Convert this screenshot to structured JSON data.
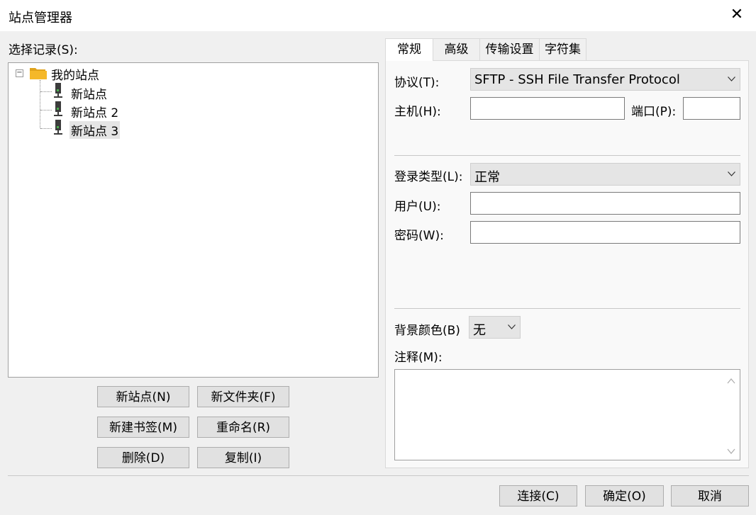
{
  "window": {
    "title": "站点管理器",
    "close_label": "✕"
  },
  "tree": {
    "label": "选择记录(S):",
    "folder": {
      "toggle": "−",
      "label": "我的站点"
    },
    "sites": [
      {
        "label": "新站点",
        "selected": false
      },
      {
        "label": "新站点 2",
        "selected": false
      },
      {
        "label": "新站点 3",
        "selected": true
      }
    ]
  },
  "left_buttons": {
    "new_site": "新站点(N)",
    "new_folder": "新文件夹(F)",
    "new_bookmark": "新建书签(M)",
    "rename": "重命名(R)",
    "delete": "删除(D)",
    "copy": "复制(I)"
  },
  "tabs": [
    {
      "label": "常规",
      "active": true
    },
    {
      "label": "高级",
      "active": false
    },
    {
      "label": "传输设置",
      "active": false
    },
    {
      "label": "字符集",
      "active": false
    }
  ],
  "general": {
    "protocol_label": "协议(T):",
    "protocol_value": "SFTP - SSH File Transfer Protocol",
    "host_label": "主机(H):",
    "host_value": "",
    "port_label": "端口(P):",
    "port_value": "",
    "logon_type_label": "登录类型(L):",
    "logon_type_value": "正常",
    "user_label": "用户(U):",
    "user_value": "",
    "password_label": "密码(W):",
    "password_value": "",
    "bg_color_label": "背景颜色(B)",
    "bg_color_value": "无",
    "comments_label": "注释(M):",
    "comments_value": ""
  },
  "footer_buttons": {
    "connect": "连接(C)",
    "ok": "确定(O)",
    "cancel": "取消"
  },
  "colors": {
    "folder": "#f5b829",
    "window_bg": "#f0f0f0",
    "selection": "#e5e5e5"
  },
  "icons": {
    "folder": "folder-icon",
    "site": "server-icon",
    "dropdown": "chevron-down-icon",
    "close": "close-icon"
  }
}
